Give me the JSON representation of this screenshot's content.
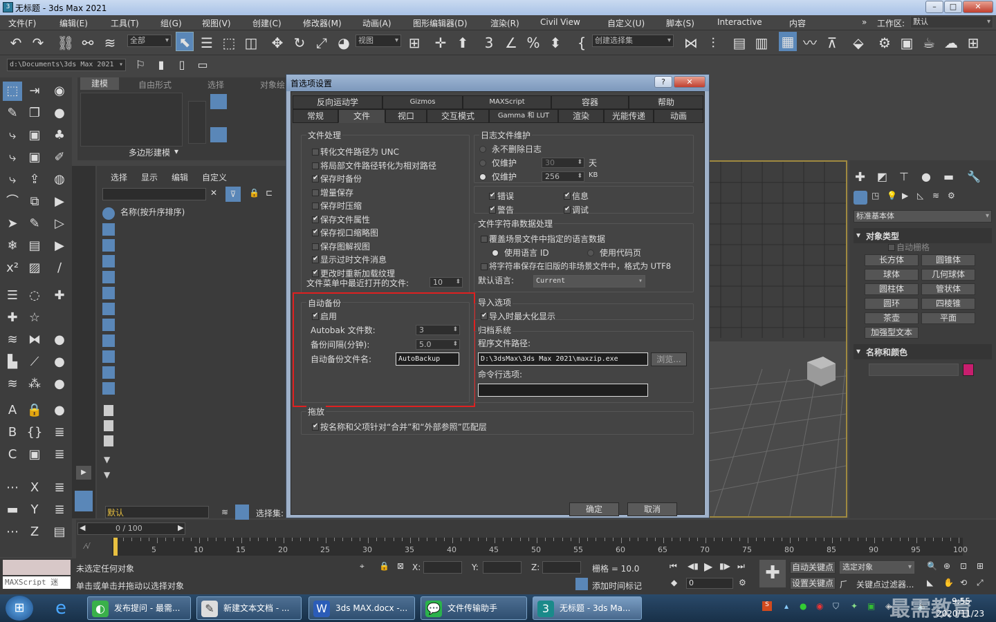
{
  "window": {
    "title": "无标题 - 3ds Max 2021"
  },
  "menu": [
    "文件(F)",
    "编辑(E)",
    "工具(T)",
    "组(G)",
    "视图(V)",
    "创建(C)",
    "修改器(M)",
    "动画(A)",
    "图形编辑器(D)",
    "渲染(R)",
    "Civil View",
    "自定义(U)",
    "脚本(S)",
    "Interactive",
    "内容"
  ],
  "workspace": {
    "label": "工作区:",
    "value": "默认"
  },
  "toolbar": {
    "filter_value": "全部",
    "view_value": "视图",
    "selection_set_placeholder": "创建选择集"
  },
  "toolbar2": {
    "path": "d:\\Documents\\3ds Max 2021"
  },
  "ribbon": {
    "tabs": [
      "建模",
      "自由形式",
      "选择",
      "对象绘"
    ],
    "section": "多边形建模"
  },
  "scene_explorer": {
    "tabs": [
      "选择",
      "显示",
      "编辑",
      "自定义"
    ],
    "column": "名称(按升序排序)",
    "layer_value": "默认",
    "selection_set_label": "选择集:"
  },
  "command_panel": {
    "dropdown": "标准基本体",
    "object_type_title": "对象类型",
    "autogrid": "自动栅格",
    "buttons": [
      "长方体",
      "圆锥体",
      "球体",
      "几何球体",
      "圆柱体",
      "管状体",
      "圆环",
      "四棱锥",
      "茶壶",
      "平面",
      "加强型文本"
    ],
    "name_color_title": "名称和颜色",
    "swatch_color": "#c81e6e"
  },
  "dialog": {
    "title": "首选项设置",
    "tabs_row1": [
      "反向运动学",
      "Gizmos",
      "MAXScript",
      "容器",
      "帮助"
    ],
    "tabs_row2": [
      "常规",
      "文件",
      "视口",
      "交互模式",
      "Gamma 和 LUT",
      "渲染",
      "光能传递",
      "动画"
    ],
    "active_tab": "文件",
    "file_handling": {
      "title": "文件处理",
      "items": [
        {
          "label": "转化文件路径为 UNC",
          "checked": false
        },
        {
          "label": "将局部文件路径转化为相对路径",
          "checked": false
        },
        {
          "label": "保存时备份",
          "checked": true
        },
        {
          "label": "增量保存",
          "checked": false
        },
        {
          "label": "保存时压缩",
          "checked": false
        },
        {
          "label": "保存文件属性",
          "checked": true
        },
        {
          "label": "保存视口缩略图",
          "checked": true
        },
        {
          "label": "保存图解视图",
          "checked": false
        },
        {
          "label": "显示过时文件消息",
          "checked": true
        },
        {
          "label": "更改时重新加载纹理",
          "checked": true
        }
      ],
      "recent_label": "文件菜单中最近打开的文件:",
      "recent_value": "10"
    },
    "log": {
      "title": "日志文件维护",
      "never_delete": "永不删除日志",
      "keep_days_label": "仅维护",
      "keep_days_value": "30",
      "days_unit": "天",
      "keep_kb_label": "仅维护",
      "keep_kb_value": "256",
      "kb_unit": "KB",
      "selected": "kb",
      "error": "错误",
      "info": "信息",
      "warning": "警告",
      "debug": "调试"
    },
    "string_data": {
      "title": "文件字符串数据处理",
      "override": "覆盖场景文件中指定的语言数据",
      "use_lang_id": "使用语言 ID",
      "use_codepage": "使用代码页",
      "save_utf8": "将字符串保存在旧版的非场景文件中，格式为 UTF8",
      "default_lang_label": "默认语言:",
      "default_lang_value": "Current"
    },
    "autobackup": {
      "title": "自动备份",
      "enable": "启用",
      "count_label": "Autobak 文件数:",
      "count_value": "3",
      "interval_label": "备份间隔(分钟):",
      "interval_value": "5.0",
      "name_label": "自动备份文件名:",
      "name_value": "AutoBackup"
    },
    "import": {
      "title": "导入选项",
      "maximize": "导入时最大化显示"
    },
    "archive": {
      "title": "归档系统",
      "program_label": "程序文件路径:",
      "program_value": "D:\\3dsMax\\3ds Max 2021\\maxzip.exe",
      "browse": "浏览...",
      "cmdline_label": "命令行选项:",
      "cmdline_value": ""
    },
    "drag": {
      "title": "拖放",
      "match": "按名称和父项针对“合并”和“外部参照”匹配层"
    },
    "ok": "确定",
    "cancel": "取消"
  },
  "timeline": {
    "frame": "0 / 100",
    "ticks": [
      "5",
      "10",
      "15",
      "20",
      "25",
      "30",
      "35",
      "40",
      "45",
      "50",
      "55",
      "60",
      "65",
      "70",
      "75",
      "80",
      "85",
      "90",
      "95",
      "100"
    ]
  },
  "status": {
    "maxscript": "MAXScript 迷",
    "line1": "未选定任何对象",
    "line2": "单击或单击并拖动以选择对象",
    "x_label": "X:",
    "y_label": "Y:",
    "z_label": "Z:",
    "grid": "栅格 = 10.0",
    "add_tag": "添加时间标记",
    "auto_key": "自动关键点",
    "selected_obj": "选定对象",
    "set_key": "设置关键点",
    "key_filter": "关键点过滤器...",
    "frame_value": "0"
  },
  "taskbar": {
    "tasks": [
      "发布提问 - 最需...",
      "新建文本文档 - ...",
      "3ds MAX.docx -...",
      "文件传输助手",
      "无标题 - 3ds Ma..."
    ],
    "clock_time": "9:55",
    "clock_date": "2020/11/23",
    "watermark": "最需教育"
  }
}
